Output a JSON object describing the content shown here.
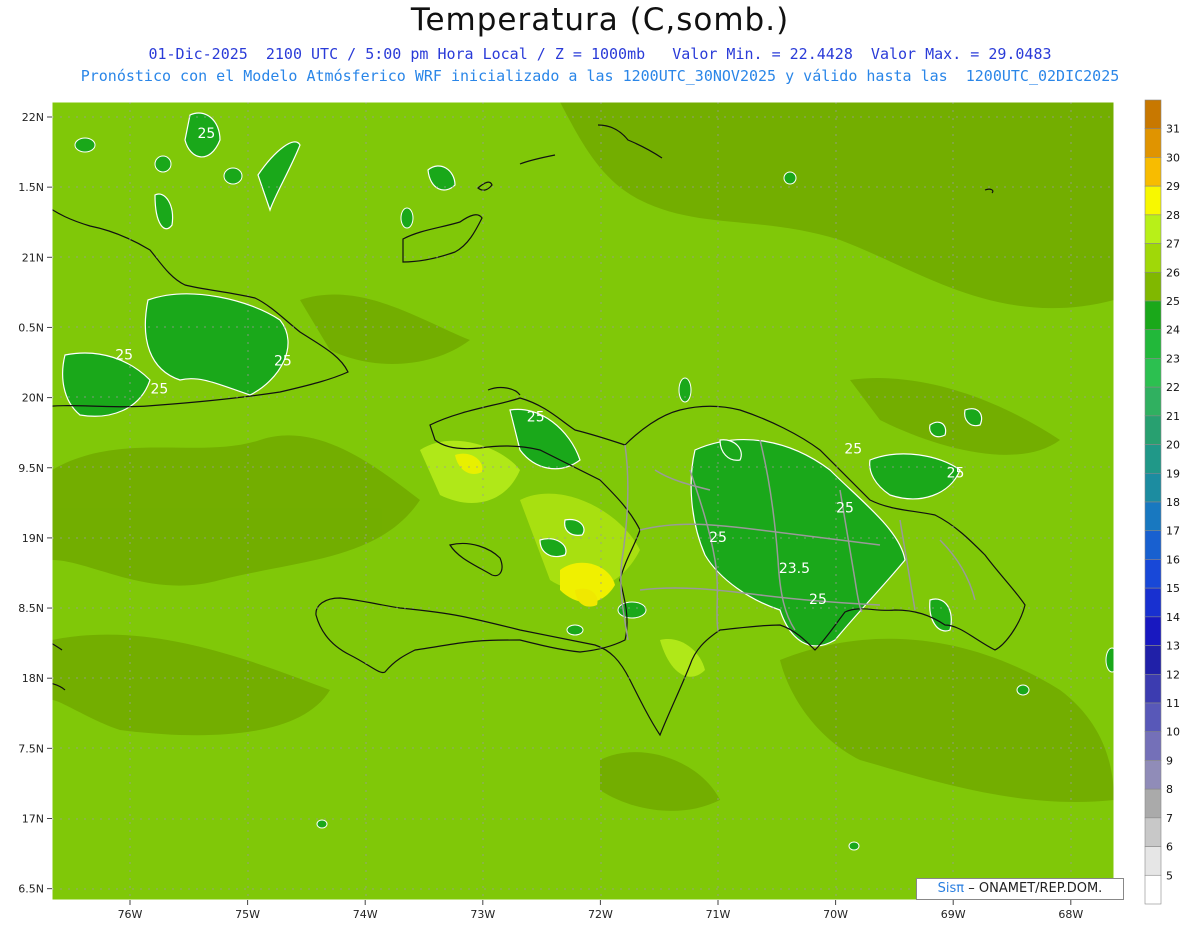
{
  "header": {
    "title": "Temperatura (C,somb.)",
    "line1": "01-Dic-2025  2100 UTC / 5:00 pm Hora Local / Z = 1000mb   Valor Min. = 22.4428  Valor Max. = 29.0483",
    "line2": "Pronóstico con el Modelo Atmósferico WRF inicializado a las 1200UTC_30NOV2025 y válido hasta las  1200UTC_02DIC2025"
  },
  "axes": {
    "lat_labels": [
      "22N",
      "1.5N",
      "21N",
      "0.5N",
      "20N",
      "9.5N",
      "19N",
      "8.5N",
      "18N",
      "7.5N",
      "17N",
      "6.5N"
    ],
    "lon_labels": [
      "76W",
      "75W",
      "74W",
      "73W",
      "72W",
      "71W",
      "70W",
      "69W",
      "68W"
    ]
  },
  "map_labels": [
    {
      "text": "25",
      "lon": -75.35,
      "lat": 21.85
    },
    {
      "text": "25",
      "lon": -76.05,
      "lat": 20.27
    },
    {
      "text": "25",
      "lon": -75.75,
      "lat": 20.03
    },
    {
      "text": "25",
      "lon": -74.7,
      "lat": 20.23
    },
    {
      "text": "25",
      "lon": -72.55,
      "lat": 19.83
    },
    {
      "text": "25",
      "lon": -69.85,
      "lat": 19.6
    },
    {
      "text": "25",
      "lon": -68.98,
      "lat": 19.43
    },
    {
      "text": "25",
      "lon": -69.92,
      "lat": 19.18
    },
    {
      "text": "25",
      "lon": -71.0,
      "lat": 18.97
    },
    {
      "text": "23.5",
      "lon": -70.35,
      "lat": 18.75
    },
    {
      "text": "25",
      "lon": -70.15,
      "lat": 18.53
    }
  ],
  "colorbar": {
    "labels": [
      "31",
      "30",
      "29",
      "28",
      "27",
      "26",
      "25",
      "24",
      "23",
      "22",
      "21",
      "20",
      "19",
      "18",
      "17",
      "16",
      "15",
      "14",
      "13",
      "12",
      "11",
      "10",
      "9",
      "8",
      "7",
      "6",
      "5"
    ],
    "colors": [
      "#c87800",
      "#e09400",
      "#f8bc00",
      "#f8f800",
      "#b8f018",
      "#a0d808",
      "#80b800",
      "#1aa81a",
      "#22b83a",
      "#2cc050",
      "#30b060",
      "#28a070",
      "#209888",
      "#1c8ca0",
      "#1878c0",
      "#1860d0",
      "#1848d8",
      "#1830d0",
      "#1818c0",
      "#2020a8",
      "#3c3cb0",
      "#5858b8",
      "#7470b8",
      "#908cb8",
      "#aaaaaa",
      "#c8c8c8",
      "#e6e6e6",
      "#ffffff"
    ]
  },
  "credit": {
    "brand": "Sisπ",
    "text": "– ONAMET/REP.DOM."
  }
}
